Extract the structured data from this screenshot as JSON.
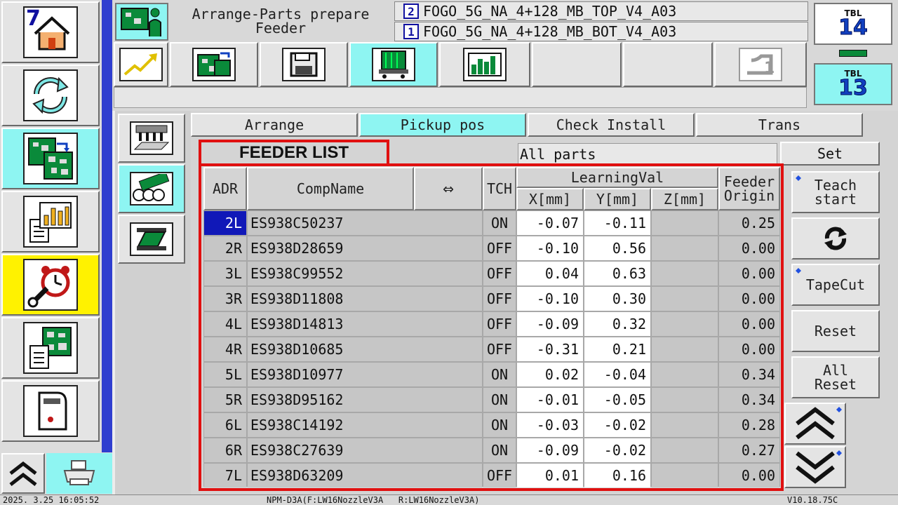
{
  "header": {
    "nav_number": "7",
    "screen_title": "Arrange-Parts prepare\nFeeder",
    "programs": [
      {
        "index": "2",
        "name": "FOGO_5G_NA_4+128_MB_TOP_V4_A03"
      },
      {
        "index": "1",
        "name": "FOGO_5G_NA_4+128_MB_BOT_V4_A03"
      }
    ],
    "tables": [
      {
        "label": "TBL",
        "number": "14"
      },
      {
        "label": "TBL",
        "number": "13"
      }
    ]
  },
  "tabs": [
    "Arrange",
    "Pickup pos",
    "Check Install",
    "Trans"
  ],
  "active_tab": "Pickup pos",
  "annotation": {
    "feeder_list": "FEEDER LIST"
  },
  "filter": {
    "value": "All parts",
    "set_label": "Set"
  },
  "table": {
    "headers": {
      "adr": "ADR",
      "compname": "CompName",
      "swap": "⇔",
      "tch": "TCH",
      "learning": "LearningVal",
      "x": "X[mm]",
      "y": "Y[mm]",
      "z": "Z[mm]",
      "origin": "Feeder\nOrigin"
    },
    "rows": [
      {
        "adr": "2L",
        "comp": "ES938C50237",
        "tch": "ON",
        "x": "-0.07",
        "y": "-0.11",
        "z": "",
        "origin": "0.25"
      },
      {
        "adr": "2R",
        "comp": "ES938D28659",
        "tch": "OFF",
        "x": "-0.10",
        "y": "0.56",
        "z": "",
        "origin": "0.00"
      },
      {
        "adr": "3L",
        "comp": "ES938C99552",
        "tch": "OFF",
        "x": "0.04",
        "y": "0.63",
        "z": "",
        "origin": "0.00"
      },
      {
        "adr": "3R",
        "comp": "ES938D11808",
        "tch": "OFF",
        "x": "-0.10",
        "y": "0.30",
        "z": "",
        "origin": "0.00"
      },
      {
        "adr": "4L",
        "comp": "ES938D14813",
        "tch": "OFF",
        "x": "-0.09",
        "y": "0.32",
        "z": "",
        "origin": "0.00"
      },
      {
        "adr": "4R",
        "comp": "ES938D10685",
        "tch": "OFF",
        "x": "-0.31",
        "y": "0.21",
        "z": "",
        "origin": "0.00"
      },
      {
        "adr": "5L",
        "comp": "ES938D10977",
        "tch": "ON",
        "x": "0.02",
        "y": "-0.04",
        "z": "",
        "origin": "0.34"
      },
      {
        "adr": "5R",
        "comp": "ES938D95162",
        "tch": "ON",
        "x": "-0.01",
        "y": "-0.05",
        "z": "",
        "origin": "0.34"
      },
      {
        "adr": "6L",
        "comp": "ES938C14192",
        "tch": "ON",
        "x": "-0.03",
        "y": "-0.02",
        "z": "",
        "origin": "0.28"
      },
      {
        "adr": "6R",
        "comp": "ES938C27639",
        "tch": "ON",
        "x": "-0.09",
        "y": "-0.02",
        "z": "",
        "origin": "0.27"
      },
      {
        "adr": "7L",
        "comp": "ES938D63209",
        "tch": "OFF",
        "x": "0.01",
        "y": "0.16",
        "z": "",
        "origin": "0.00"
      }
    ],
    "selected_row": 0
  },
  "actions": {
    "teach_start": "Teach\nstart",
    "tape_cut": "TapeCut",
    "reset": "Reset",
    "all_reset": "All\nReset"
  },
  "status": {
    "datetime": "2025. 3.25 16:05:52",
    "machine": "NPM-D3A(F:LW16NozzleV3A   R:LW16NozzleV3A)",
    "version": "V10.18.75C"
  },
  "colors": {
    "active_cyan": "#8ef5f2",
    "nav_blue": "#2f3ecf",
    "annotation_red": "#e01010",
    "selected_blue": "#1018b8",
    "alarm_yellow": "#fff200"
  }
}
